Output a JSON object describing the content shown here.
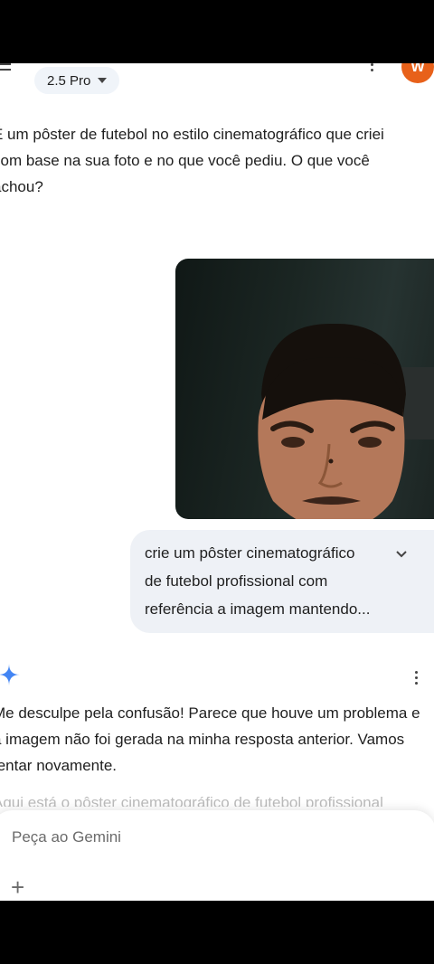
{
  "header": {
    "model_label": "2.5 Pro",
    "avatar_initial": "W",
    "avatar_color": "#e8611a"
  },
  "conversation": {
    "prev_ai_text": "É um pôster de futebol no estilo cinematográfico que criei\ncom base na sua foto e no que você pediu. O que você\nachou?",
    "user_prompt": "crie um pôster cinematográfico\nde futebol profissional com\nreferência a imagem mantendo...",
    "ai_reply": "Me desculpe pela confusão! Parece que houve um problema e\na imagem não foi gerada na minha resposta anterior. Vamos\ntentar novamente.",
    "ai_reply_faded": "Aqui está o pôster cinematográfico de futebol profissional"
  },
  "input": {
    "placeholder": "Peça ao Gemini"
  },
  "colors": {
    "accent": "#4285f4",
    "bubble": "#eef1f6"
  }
}
